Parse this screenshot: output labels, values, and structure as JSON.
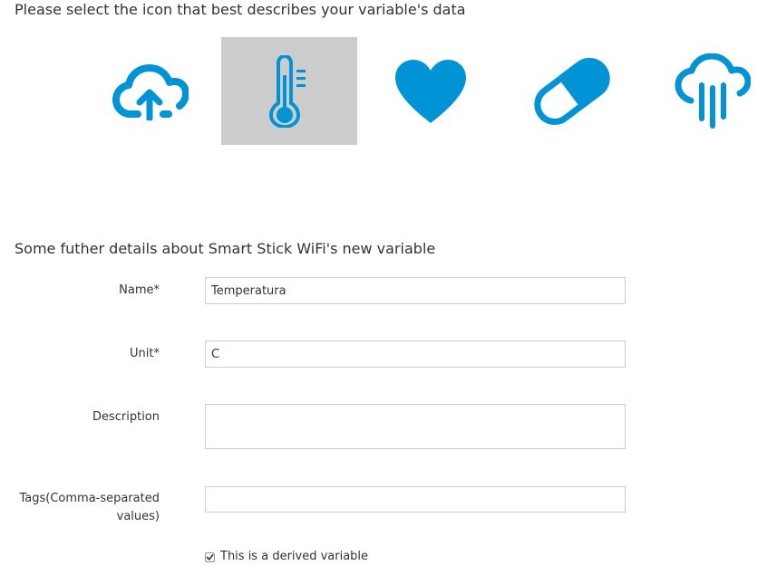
{
  "icon_section": {
    "heading": "Please select the icon that best describes your variable's data",
    "icons": [
      {
        "name": "cloud-upload-icon",
        "selected": false
      },
      {
        "name": "thermometer-icon",
        "selected": true
      },
      {
        "name": "heart-icon",
        "selected": false
      },
      {
        "name": "pill-icon",
        "selected": false
      },
      {
        "name": "cloud-rain-icon",
        "selected": false
      }
    ],
    "icon_color": "#0093d6",
    "selected_bg": "#cccccc"
  },
  "details_section": {
    "heading": "Some futher details about Smart Stick WiFi's new variable",
    "fields": {
      "name": {
        "label": "Name*",
        "value": "Temperatura"
      },
      "unit": {
        "label": "Unit*",
        "value": "C"
      },
      "description": {
        "label": "Description",
        "value": ""
      },
      "tags": {
        "label_line1": "Tags(Comma-separated",
        "label_line2": "values)",
        "value": ""
      }
    },
    "derived": {
      "label": "This is a derived variable",
      "checked": true
    }
  }
}
